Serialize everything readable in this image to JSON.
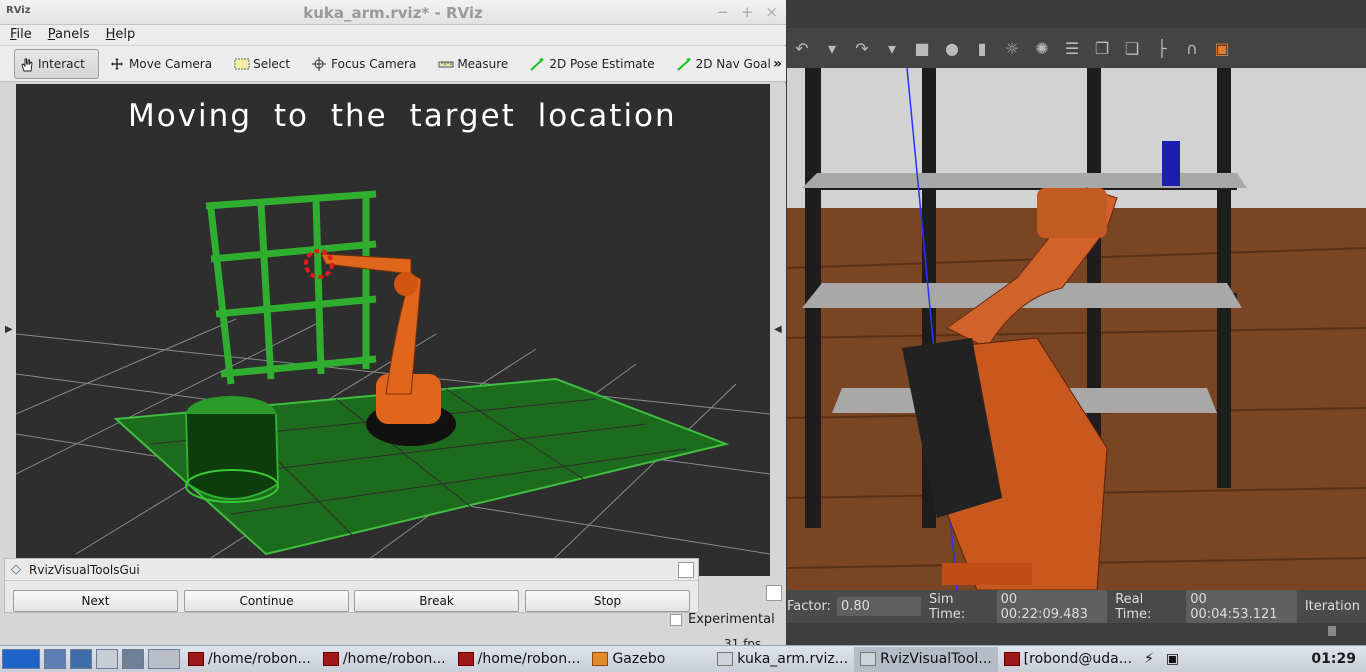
{
  "rviz": {
    "title": "kuka_arm.rviz* - RViz",
    "app_icon": "RViz",
    "window_buttons": [
      "−",
      "+",
      "×"
    ],
    "menu": [
      {
        "accel": "F",
        "rest": "ile"
      },
      {
        "accel": "P",
        "rest": "anels"
      },
      {
        "accel": "H",
        "rest": "elp"
      }
    ],
    "tools": [
      "Interact",
      "Move Camera",
      "Select",
      "Focus Camera",
      "Measure",
      "2D Pose Estimate",
      "2D Nav Goal"
    ],
    "overflow": "»",
    "viewport_text": "Moving to the target location",
    "visual_tools": {
      "title": "RvizVisualToolsGui",
      "buttons": [
        "Next",
        "Continue",
        "Break",
        "Stop"
      ]
    },
    "time_panel": {
      "experimental": "Experimental",
      "fps": "31 fps"
    }
  },
  "gazebo": {
    "status": {
      "factor_label": "Factor:",
      "factor_value": "0.80",
      "sim_time_label": "Sim Time:",
      "sim_time_value": "00 00:22:09.483",
      "real_time_label": "Real Time:",
      "real_time_value": "00 00:04:53.121",
      "iterations_label": "Iteration"
    }
  },
  "taskbar": {
    "tasks": [
      "/home/robon...",
      "/home/robon...",
      "/home/robon...",
      "Gazebo",
      "kuka_arm.rviz...",
      "RvizVisualTool...",
      "[robond@uda..."
    ],
    "clock": "01:29"
  },
  "colors": {
    "accent_orange": "#e0661c",
    "shelf_green": "#2fae2f",
    "target_blue": "#1b1fa8"
  }
}
